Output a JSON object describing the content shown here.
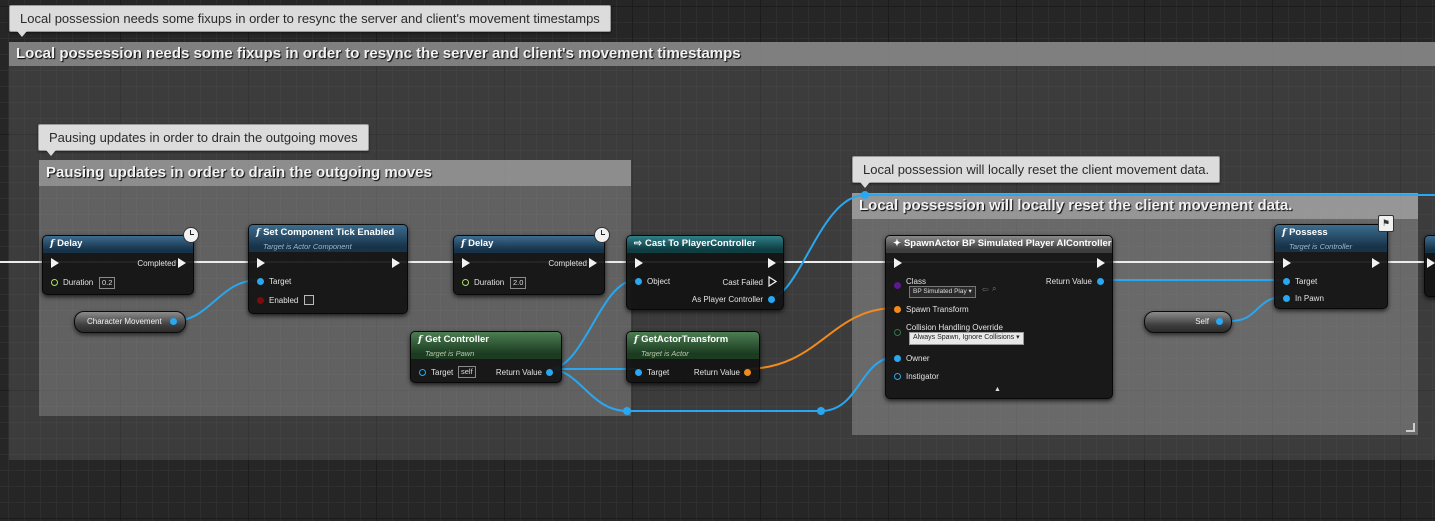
{
  "tooltips": {
    "outer": "Local possession needs some fixups in order to resync the server and client's movement timestamps",
    "pausing": "Pausing updates in order to drain the outgoing moves",
    "local": "Local possession will locally reset the client movement data."
  },
  "comments": {
    "outer": "Local possession needs some fixups in order to resync the server and client's movement timestamps",
    "pausing": "Pausing updates in order to drain the outgoing moves",
    "local": "Local possession will locally reset the client movement data."
  },
  "nodes": {
    "delay1": {
      "title": "Delay",
      "completed": "Completed",
      "duration_label": "Duration",
      "duration_value": "0.2"
    },
    "tick": {
      "title": "Set Component Tick Enabled",
      "subtitle": "Target is Actor Component",
      "target": "Target",
      "enabled": "Enabled"
    },
    "delay2": {
      "title": "Delay",
      "completed": "Completed",
      "duration_label": "Duration",
      "duration_value": "2.0"
    },
    "cast": {
      "title": "Cast To PlayerController",
      "object": "Object",
      "cast_failed": "Cast Failed",
      "as_player": "As Player Controller"
    },
    "get_controller": {
      "title": "Get Controller",
      "subtitle": "Target is Pawn",
      "target": "Target",
      "target_value": "self",
      "return": "Return Value"
    },
    "get_transform": {
      "title": "GetActorTransform",
      "subtitle": "Target is Actor",
      "target": "Target",
      "return": "Return Value"
    },
    "spawn": {
      "title": "SpawnActor BP Simulated Player AIController",
      "class_label": "Class",
      "class_value": "BP Simulated Play",
      "return": "Return Value",
      "spawn_transform": "Spawn Transform",
      "collision_label": "Collision Handling Override",
      "collision_value": "Always Spawn, Ignore Collisions",
      "owner": "Owner",
      "instigator": "Instigator"
    },
    "possess": {
      "title": "Possess",
      "subtitle": "Target is Controller",
      "target": "Target",
      "in_pawn": "In Pawn"
    },
    "character_movement": {
      "label": "Character Movement"
    },
    "self_node": {
      "label": "Self"
    }
  },
  "colors": {
    "exec": "#f2f2f2",
    "object_pin": "#29a7f0",
    "transform_pin": "#f28a1d",
    "float_pin": "#a8e05a"
  }
}
